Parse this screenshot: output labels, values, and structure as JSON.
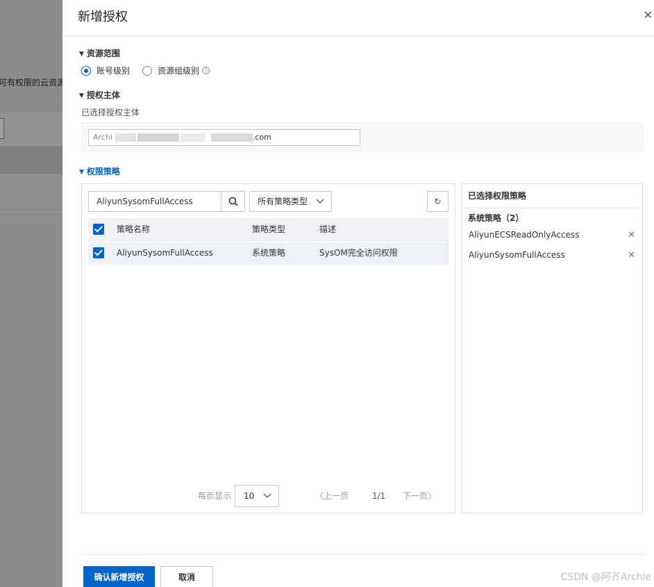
{
  "background": {
    "text": "可有权限的云资源"
  },
  "drawer": {
    "title": "新增授权",
    "close_icon": "close-icon"
  },
  "scope": {
    "heading": "资源范围",
    "options": [
      {
        "label": "账号级别",
        "checked": true
      },
      {
        "label": "资源组级别",
        "checked": false
      }
    ],
    "help_icon": "help-icon"
  },
  "principal": {
    "heading": "授权主体",
    "selected_label": "已选择授权主体",
    "value_visible": "Archi",
    "value_suffix": ".com"
  },
  "policy": {
    "heading": "权限策略",
    "search_value": "AliyunSysomFullAccess",
    "type_filter": "所有策略类型",
    "columns": {
      "name": "策略名称",
      "type": "策略类型",
      "desc": "描述"
    },
    "rows": [
      {
        "name": "AliyunSysomFullAccess",
        "type": "系统策略",
        "desc": "SysOM完全访问权限",
        "checked": true
      }
    ],
    "pager": {
      "per_page_label": "每页显示",
      "per_page_value": "10",
      "prev": "上一页",
      "page": "1/1",
      "next": "下一页"
    }
  },
  "selected": {
    "title": "已选择权限策略",
    "group_label": "系统策略",
    "group_count": "（2）",
    "items": [
      "AliyunECSReadOnlyAccess",
      "AliyunSysomFullAccess"
    ]
  },
  "footer": {
    "confirm": "确认新增授权",
    "cancel": "取消"
  },
  "watermark": "CSDN @阿齐Archie",
  "colors": {
    "primary": "#0064c8",
    "overlay": "#8c8c8c"
  }
}
